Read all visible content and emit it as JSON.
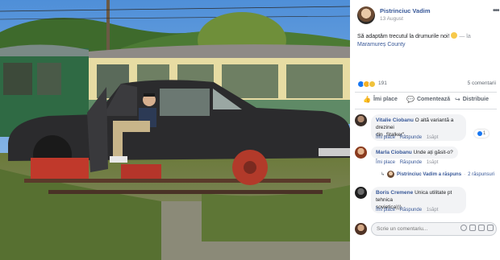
{
  "post": {
    "author": "Pistrinciuc Vadim",
    "date": "13 August",
    "more": "•••",
    "text": "Să adaptăm trecutul la drumurile noi!",
    "location_sep": "— la",
    "location": "Maramureș County"
  },
  "reactions": {
    "count": "191",
    "comments": "5 comentarii"
  },
  "actions": {
    "like": "Îmi place",
    "comment": "Comentează",
    "share": "Distribuie"
  },
  "comments": [
    {
      "name": "Vitalie Ciobanu",
      "text_line1": "O altă variantă a drezinei",
      "text_line2": "din „Stalker\"...",
      "like": "Îmi place",
      "reply": "Răspunde",
      "time": "1săpt",
      "likes": "1"
    },
    {
      "name": "Marla Ciobanu",
      "text_line1": "Unde ați găsit-o?",
      "like": "Îmi place",
      "reply": "Răspunde",
      "time": "1săpt",
      "reply_author": "Pistrinciuc Vadim a răspuns",
      "reply_sep": "·",
      "reply_count": "2 răspunsuri"
    },
    {
      "name": "Boris Cremene",
      "text_line1": "Unica utilitate pt tehnica",
      "text_line2": "sovietica)))",
      "like": "Îmi place",
      "reply": "Răspunde",
      "time": "1săpt"
    }
  ],
  "composer": {
    "placeholder": "Scrie un comentariu..."
  },
  "colors": {
    "link": "#385898",
    "like_blue": "#1877f2",
    "bubble_bg": "#f2f3f5",
    "meta_gray": "#90949c"
  },
  "icons": {
    "like": "thumbs-up-icon",
    "comment": "speech-bubble-icon",
    "share": "share-arrow-icon"
  }
}
